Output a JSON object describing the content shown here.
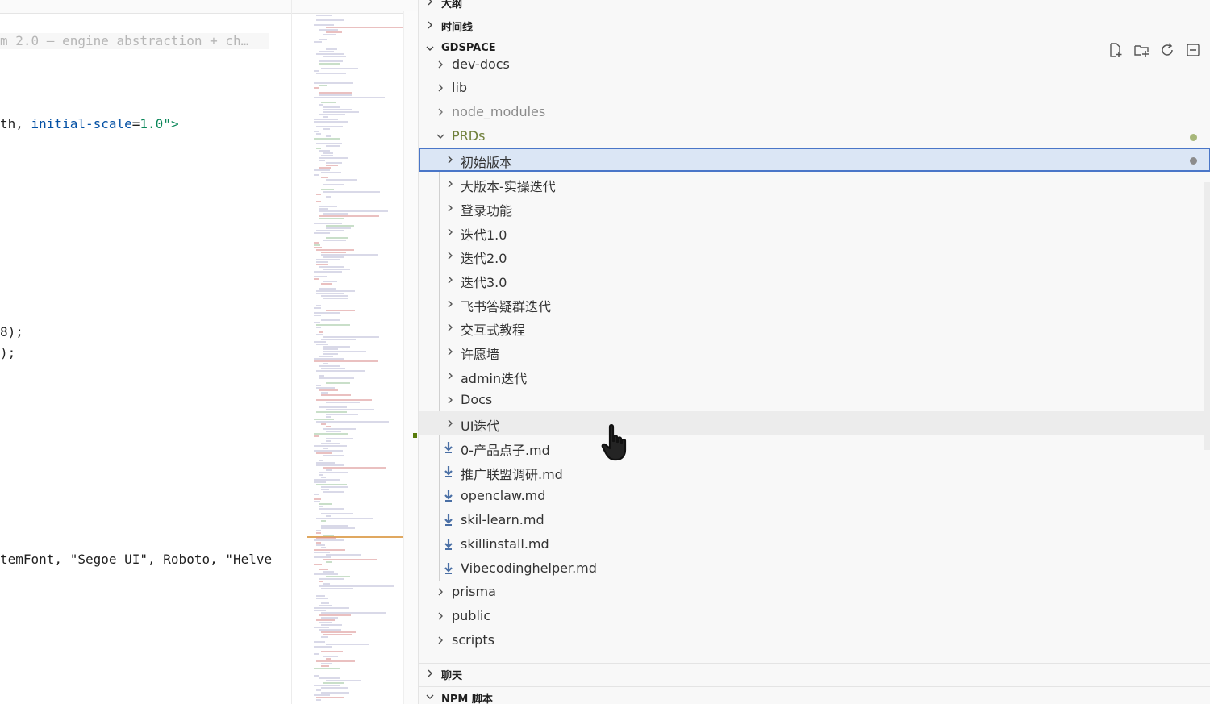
{
  "editor": {
    "lines": [
      {
        "text": "m 2.0 — engine abstraction + ch…",
        "kind": "faded"
      },
      {
        "pre": "th, ",
        "attr": "initial-scale",
        "mid": "=",
        "str": "1.0\">"
      },
      {
        "text": "8);"
      },
      {
        "text": ");"
      },
      {
        "text": "temFont, \"Segoe UI\", Roboto, \"Helve"
      }
    ]
  },
  "explorer": {
    "sections": {
      "outline": "大纲",
      "timeline": "时间线",
      "workspace": "GDSPACE",
      "chat": "聊天",
      "npm": "NPM 脚本"
    },
    "tree": {
      "dev_docs": "dev-docs",
      "lib": "lib",
      "node_modules": "node_modules",
      "prds": "PRDs",
      "prds_children": [
        {
          "label": "初始版本",
          "type": "folder"
        },
        {
          "label": "大版本-实操迭代",
          "type": "folder"
        },
        {
          "label": "登录功能",
          "type": "folder"
        },
        {
          "label": "迭代1.0",
          "type": "folder"
        },
        {
          "label": "迭代2.0",
          "type": "folder"
        },
        {
          "label": "迭代3.0",
          "type": "folder"
        },
        {
          "label": "飞书答疑群迭代",
          "type": "folder"
        },
        {
          "label": "交互式教程",
          "type": "folder"
        },
        {
          "label": "许愿墙",
          "type": "folder"
        },
        {
          "label": "admin迭代",
          "type": "folder"
        },
        {
          "label": "Docs",
          "type": "folder"
        },
        {
          "label": "UI迭代",
          "type": "folder"
        },
        {
          "label": "0-产品点子.md",
          "type": "md"
        },
        {
          "label": "推广联盟调研.md",
          "type": "md"
        },
        {
          "label": "openclaw.md",
          "type": "md"
        },
        {
          "label": "skil-learn.md",
          "type": "md"
        },
        {
          "label": "skillinstall.md",
          "type": "md"
        },
        {
          "label": "Vibecodinghelper.md",
          "type": "md"
        }
      ],
      "prisma": "prisma",
      "public": "public",
      "scripts": "scripts"
    },
    "colors": {
      "selection_bg": "#dbe6f5",
      "selection_border": "#4a76c8",
      "modified_dot_green": "#a7b77a",
      "modified_dot_gray": "#8c8c8c",
      "md_icon": "#4a6fa5"
    }
  }
}
